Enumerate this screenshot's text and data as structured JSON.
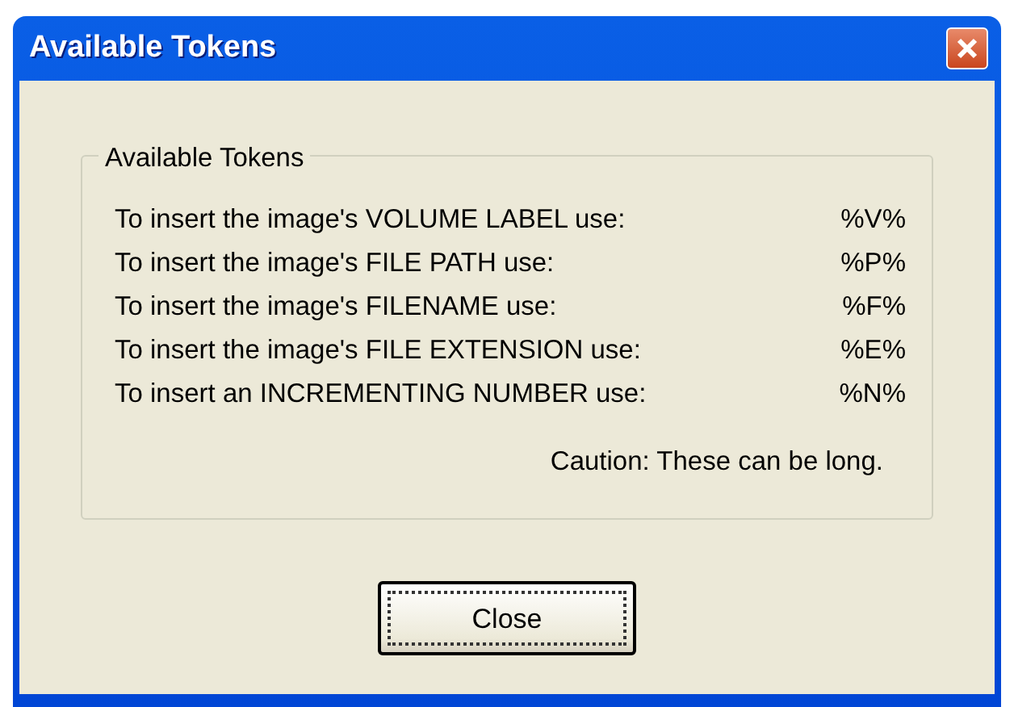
{
  "window": {
    "title": "Available Tokens"
  },
  "group": {
    "title": "Available Tokens",
    "tokens": [
      {
        "label": "To insert the image's VOLUME LABEL use:",
        "token": "%V%"
      },
      {
        "label": "To insert the image's FILE PATH use:",
        "token": "%P%"
      },
      {
        "label": "To insert the image's FILENAME use:",
        "token": "%F%"
      },
      {
        "label": "To insert the image's FILE EXTENSION use:",
        "token": "%E%"
      },
      {
        "label": "To insert an INCREMENTING NUMBER use:",
        "token": "%N%"
      }
    ],
    "caution": "Caution: These can be long."
  },
  "buttons": [
    {
      "label": "Close",
      "focused": true
    }
  ]
}
